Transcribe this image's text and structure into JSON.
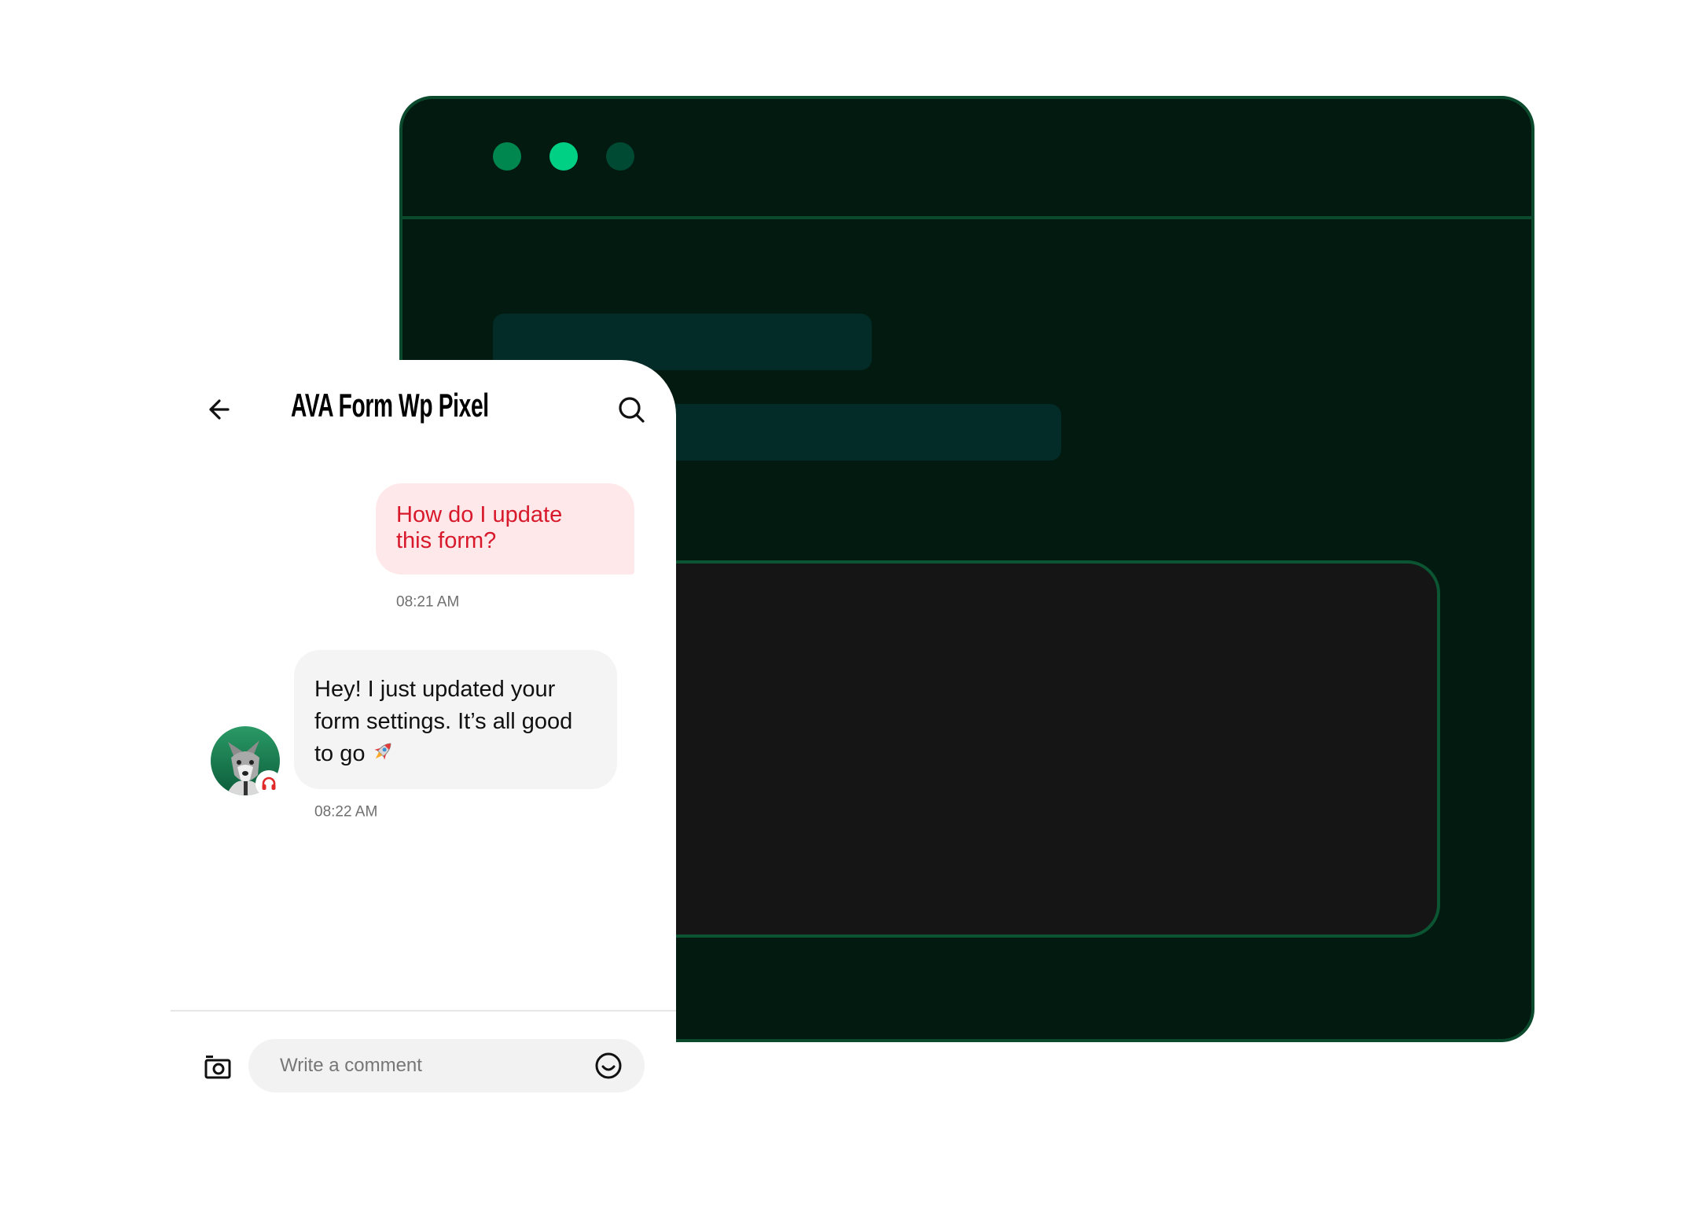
{
  "window": {
    "dots": [
      {
        "name": "window-dot-1",
        "color": "#00874f"
      },
      {
        "name": "window-dot-2",
        "color": "#00d084"
      },
      {
        "name": "window-dot-3",
        "color": "#004a33"
      }
    ],
    "colors": {
      "background": "#021a10",
      "border": "#0c4a2e",
      "skeleton": "#032b27",
      "content_box": "#151515"
    }
  },
  "chat": {
    "title": "AVA Form Wp Pixel",
    "header_icons": {
      "back": "arrow-left-icon",
      "search": "search-icon"
    },
    "messages": [
      {
        "sender": "user",
        "text": "How do I update this form?",
        "time": "08:21 AM"
      },
      {
        "sender": "agent",
        "text": "Hey! I just updated your form settings. It’s all good to go",
        "emoji": "rocket-icon",
        "time": "08:22 AM",
        "avatar": "wolf-avatar",
        "badge": "headphones-icon"
      }
    ],
    "composer": {
      "placeholder": "Write a comment",
      "value": "",
      "left_icon": "camera-icon",
      "right_icon": "smiley-icon"
    },
    "colors": {
      "user_bubble": "#ffe8ea",
      "user_text": "#d7192b",
      "agent_bubble": "#f4f4f4"
    }
  }
}
